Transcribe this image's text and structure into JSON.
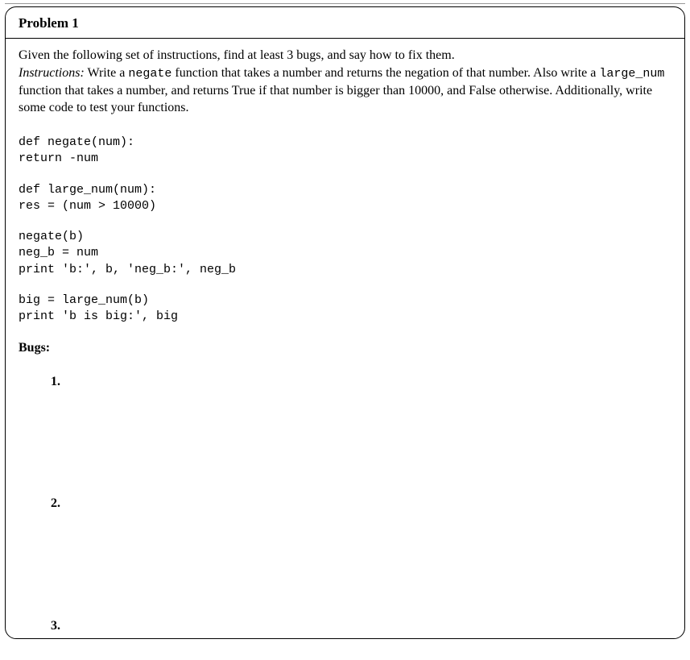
{
  "problem": {
    "title": "Problem 1",
    "intro": "Given the following set of instructions, find at least 3 bugs, and say how to fix them.",
    "instructions_label": "Instructions:",
    "instructions_pre": " Write a ",
    "code_negate": "negate",
    "instructions_mid1": " function that takes a number and returns the negation of that number. Also write a ",
    "code_largenum": "large_num",
    "instructions_mid2": " function that takes a number, and returns True if that number is bigger than 10000, and False otherwise. Additionally, write some code to test your functions.",
    "code": {
      "block1": "def negate(num):\nreturn -num",
      "block2": "def large_num(num):\nres = (num > 10000)",
      "block3": "negate(b)\nneg_b = num\nprint 'b:', b, 'neg_b:', neg_b",
      "block4": "big = large_num(b)\nprint 'b is big:', big"
    },
    "bugs_heading": "Bugs:",
    "answers": {
      "a1": "1.",
      "a2": "2.",
      "a3": "3."
    }
  }
}
